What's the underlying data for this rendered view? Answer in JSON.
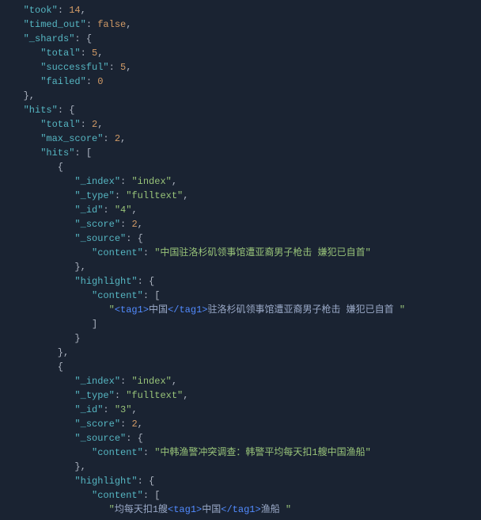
{
  "lines": [
    [
      [
        "k",
        "   \"took\""
      ],
      [
        "p",
        ": "
      ],
      [
        "n",
        "14"
      ],
      [
        "p",
        ","
      ]
    ],
    [
      [
        "k",
        "   \"timed_out\""
      ],
      [
        "p",
        ": "
      ],
      [
        "b",
        "false"
      ],
      [
        "p",
        ","
      ]
    ],
    [
      [
        "k",
        "   \"_shards\""
      ],
      [
        "p",
        ": {"
      ]
    ],
    [
      [
        "k",
        "      \"total\""
      ],
      [
        "p",
        ": "
      ],
      [
        "n",
        "5"
      ],
      [
        "p",
        ","
      ]
    ],
    [
      [
        "k",
        "      \"successful\""
      ],
      [
        "p",
        ": "
      ],
      [
        "n",
        "5"
      ],
      [
        "p",
        ","
      ]
    ],
    [
      [
        "k",
        "      \"failed\""
      ],
      [
        "p",
        ": "
      ],
      [
        "n",
        "0"
      ]
    ],
    [
      [
        "p",
        "   },"
      ]
    ],
    [
      [
        "k",
        "   \"hits\""
      ],
      [
        "p",
        ": {"
      ]
    ],
    [
      [
        "k",
        "      \"total\""
      ],
      [
        "p",
        ": "
      ],
      [
        "n",
        "2"
      ],
      [
        "p",
        ","
      ]
    ],
    [
      [
        "k",
        "      \"max_score\""
      ],
      [
        "p",
        ": "
      ],
      [
        "n",
        "2"
      ],
      [
        "p",
        ","
      ]
    ],
    [
      [
        "k",
        "      \"hits\""
      ],
      [
        "p",
        ": ["
      ]
    ],
    [
      [
        "p",
        "         {"
      ]
    ],
    [
      [
        "k",
        "            \"_index\""
      ],
      [
        "p",
        ": "
      ],
      [
        "s",
        "\"index\""
      ],
      [
        "p",
        ","
      ]
    ],
    [
      [
        "k",
        "            \"_type\""
      ],
      [
        "p",
        ": "
      ],
      [
        "s",
        "\"fulltext\""
      ],
      [
        "p",
        ","
      ]
    ],
    [
      [
        "k",
        "            \"_id\""
      ],
      [
        "p",
        ": "
      ],
      [
        "s",
        "\"4\""
      ],
      [
        "p",
        ","
      ]
    ],
    [
      [
        "k",
        "            \"_score\""
      ],
      [
        "p",
        ": "
      ],
      [
        "n",
        "2"
      ],
      [
        "p",
        ","
      ]
    ],
    [
      [
        "k",
        "            \"_source\""
      ],
      [
        "p",
        ": {"
      ]
    ],
    [
      [
        "k",
        "               \"content\""
      ],
      [
        "p",
        ": "
      ],
      [
        "s",
        "\"中国驻洛杉矶领事馆遭亚裔男子枪击 嫌犯已自首\""
      ]
    ],
    [
      [
        "p",
        "            },"
      ]
    ],
    [
      [
        "k",
        "            \"highlight\""
      ],
      [
        "p",
        ": {"
      ]
    ],
    [
      [
        "k",
        "               \"content\""
      ],
      [
        "p",
        ": ["
      ]
    ],
    [
      [
        "s",
        "                  \""
      ],
      [
        "t",
        "<tag1>"
      ],
      [
        "c",
        "中国"
      ],
      [
        "t",
        "</tag1>"
      ],
      [
        "c",
        "驻洛杉矶领事馆遭亚裔男子枪击 嫌犯已自首 "
      ],
      [
        "s",
        "\""
      ]
    ],
    [
      [
        "p",
        "               ]"
      ]
    ],
    [
      [
        "p",
        "            }"
      ]
    ],
    [
      [
        "p",
        "         },"
      ]
    ],
    [
      [
        "p",
        "         {"
      ]
    ],
    [
      [
        "k",
        "            \"_index\""
      ],
      [
        "p",
        ": "
      ],
      [
        "s",
        "\"index\""
      ],
      [
        "p",
        ","
      ]
    ],
    [
      [
        "k",
        "            \"_type\""
      ],
      [
        "p",
        ": "
      ],
      [
        "s",
        "\"fulltext\""
      ],
      [
        "p",
        ","
      ]
    ],
    [
      [
        "k",
        "            \"_id\""
      ],
      [
        "p",
        ": "
      ],
      [
        "s",
        "\"3\""
      ],
      [
        "p",
        ","
      ]
    ],
    [
      [
        "k",
        "            \"_score\""
      ],
      [
        "p",
        ": "
      ],
      [
        "n",
        "2"
      ],
      [
        "p",
        ","
      ]
    ],
    [
      [
        "k",
        "            \"_source\""
      ],
      [
        "p",
        ": {"
      ]
    ],
    [
      [
        "k",
        "               \"content\""
      ],
      [
        "p",
        ": "
      ],
      [
        "s",
        "\"中韩渔警冲突调查：韩警平均每天扣1艘中国渔船\""
      ]
    ],
    [
      [
        "p",
        "            },"
      ]
    ],
    [
      [
        "k",
        "            \"highlight\""
      ],
      [
        "p",
        ": {"
      ]
    ],
    [
      [
        "k",
        "               \"content\""
      ],
      [
        "p",
        ": ["
      ]
    ],
    [
      [
        "s",
        "                  \""
      ],
      [
        "c",
        "均每天扣1艘"
      ],
      [
        "t",
        "<tag1>"
      ],
      [
        "c",
        "中国"
      ],
      [
        "t",
        "</tag1>"
      ],
      [
        "c",
        "渔船 "
      ],
      [
        "s",
        "\""
      ]
    ]
  ]
}
